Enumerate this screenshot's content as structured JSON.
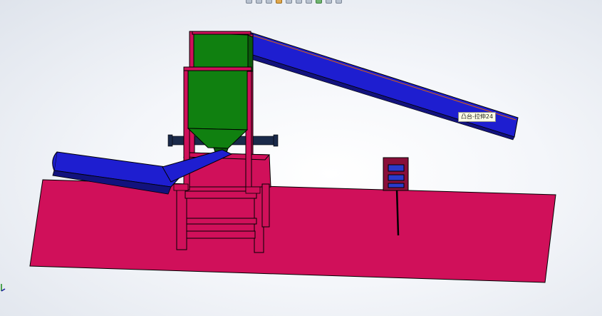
{
  "viewport": {
    "background": "#eef1f6"
  },
  "toolbar": {
    "icons": [
      "zoom-fit-icon",
      "zoom-area-icon",
      "previous-view-icon",
      "section-view-icon",
      "view-orientation-icon",
      "display-style-icon",
      "hide-show-icon",
      "edit-appearance-icon",
      "apply-scene-icon",
      "view-settings-icon"
    ]
  },
  "tooltip": {
    "text": "凸台-拉伸24"
  },
  "colors": {
    "base_plate": "#d0105a",
    "frame": "#d0105a",
    "hopper": "#108010",
    "conveyor": "#1e1ed0",
    "axle": "#1a2a4a",
    "control_box": "#8a0f3a",
    "screen": "#2a3acc",
    "edge": "#000000",
    "highlight": "#d86010"
  }
}
